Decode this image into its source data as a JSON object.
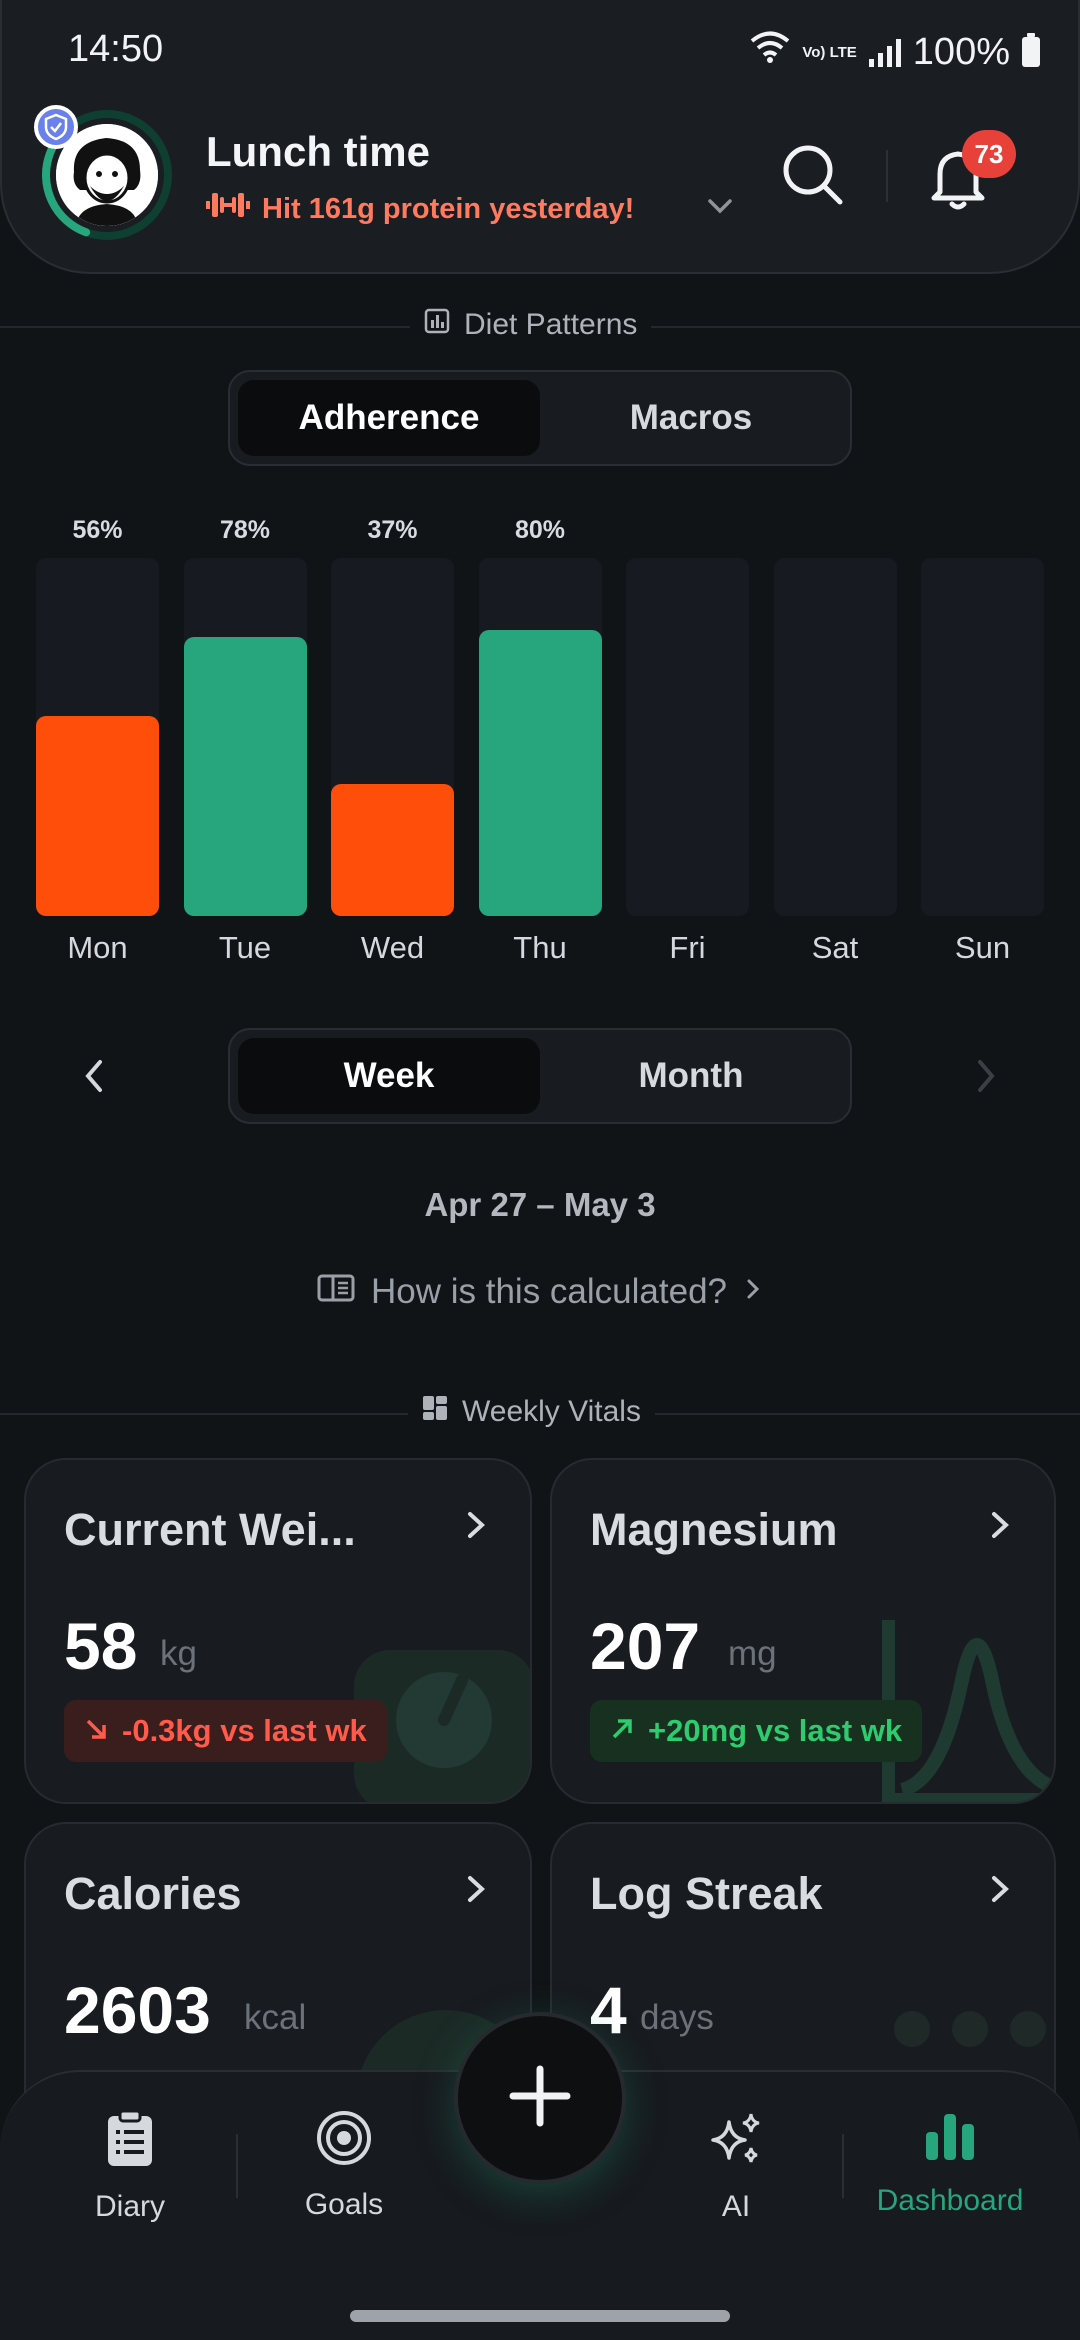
{
  "status_bar": {
    "time": "14:50",
    "network": "Vo) LTE",
    "battery": "100%",
    "icons": [
      "wifi-icon",
      "signal-icon",
      "battery-icon"
    ]
  },
  "header": {
    "title": "Lunch time",
    "subtitle": "Hit 161g protein yesterday!",
    "subtitle_icon": "dumbbell-icon",
    "notification_count": "73",
    "avatar_progress": 0.3
  },
  "diet_patterns": {
    "section_title": "Diet Patterns",
    "tabs": [
      "Adherence",
      "Macros"
    ],
    "active_tab": 0
  },
  "chart_data": {
    "type": "bar",
    "categories": [
      "Mon",
      "Tue",
      "Wed",
      "Thu",
      "Fri",
      "Sat",
      "Sun"
    ],
    "values": [
      56,
      78,
      37,
      80,
      null,
      null,
      null
    ],
    "labels": [
      "56%",
      "78%",
      "37%",
      "80%",
      "",
      "",
      ""
    ],
    "ylim": [
      0,
      100
    ],
    "colors": {
      "low": "#ff4d0a",
      "high": "#27a57c",
      "track": "#171a20"
    }
  },
  "period": {
    "tabs": [
      "Week",
      "Month"
    ],
    "active_tab": 0,
    "range": "Apr 27 – May 3",
    "calc_link": "How is this calculated?"
  },
  "weekly_vitals": {
    "section_title": "Weekly Vitals",
    "cards": [
      {
        "title": "Current Wei...",
        "value": "58",
        "unit": "kg",
        "delta": "-0.3kg vs last wk",
        "trend": "down"
      },
      {
        "title": "Magnesium",
        "value": "207",
        "unit": "mg",
        "delta": "+20mg vs last wk",
        "trend": "up"
      },
      {
        "title": "Calories",
        "value": "2603",
        "unit": "kcal"
      },
      {
        "title": "Log Streak",
        "value": "4",
        "unit": "days"
      }
    ]
  },
  "nav": {
    "items": [
      "Diary",
      "Goals",
      "AI",
      "Dashboard"
    ],
    "active": "Dashboard"
  },
  "colors": {
    "accent": "#27a57c",
    "warning": "#ff4d0a",
    "badge": "#e8413a",
    "negative_text": "#ff5a4a",
    "positive_text": "#2ecb6f"
  }
}
